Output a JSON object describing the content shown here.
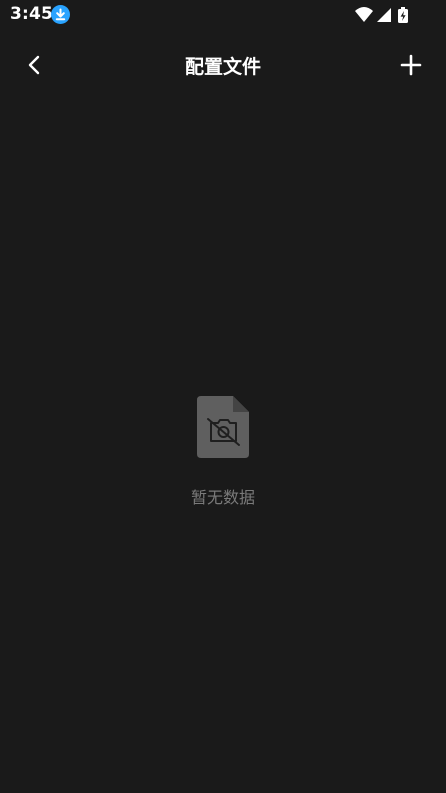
{
  "status_bar": {
    "time": "3:45",
    "icons": [
      "download-icon",
      "wifi-icon",
      "signal-icon",
      "battery-charging-icon"
    ],
    "download_color": "#29a3ff"
  },
  "header": {
    "title": "配置文件",
    "back_icon": "chevron-left-icon",
    "add_icon": "plus-icon"
  },
  "empty_state": {
    "icon": "no-file-icon",
    "message": "暂无数据",
    "text_color": "#7a7a7a"
  },
  "colors": {
    "background": "#1a1a1a",
    "foreground": "#ffffff",
    "icon_muted": "#5f5f5f"
  }
}
